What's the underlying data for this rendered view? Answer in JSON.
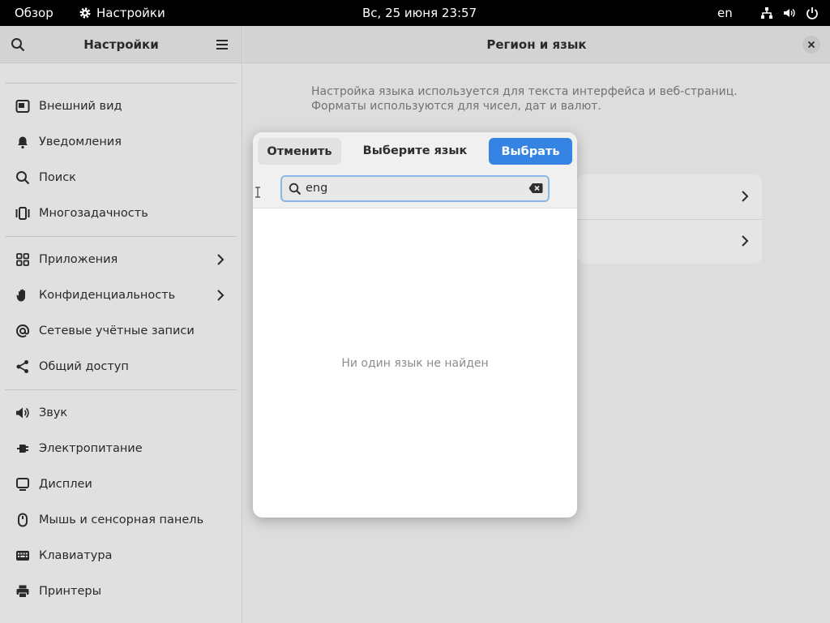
{
  "topbar": {
    "overview": "Обзор",
    "app_name": "Настройки",
    "clock": "Вс, 25 июня  23:57",
    "keyboard_layout": "en"
  },
  "sidebar": {
    "title": "Настройки",
    "items": [
      {
        "label": "Внешний вид",
        "icon": "appearance-icon"
      },
      {
        "label": "Уведомления",
        "icon": "bell-icon"
      },
      {
        "label": "Поиск",
        "icon": "search-icon"
      },
      {
        "label": "Многозадачность",
        "icon": "multitasking-icon"
      },
      {
        "label": "Приложения",
        "icon": "apps-icon"
      },
      {
        "label": "Конфиденциальность",
        "icon": "hand-icon"
      },
      {
        "label": "Сетевые учётные записи",
        "icon": "at-icon"
      },
      {
        "label": "Общий доступ",
        "icon": "share-icon"
      },
      {
        "label": "Звук",
        "icon": "speaker-icon"
      },
      {
        "label": "Электропитание",
        "icon": "power-icon"
      },
      {
        "label": "Дисплеи",
        "icon": "display-icon"
      },
      {
        "label": "Мышь и сенсорная панель",
        "icon": "mouse-icon"
      },
      {
        "label": "Клавиатура",
        "icon": "keyboard-icon"
      },
      {
        "label": "Принтеры",
        "icon": "printer-icon"
      }
    ]
  },
  "main": {
    "title": "Регион и язык",
    "description": "Настройка языка используется для текста интерфейса и веб-страниц. Форматы используются для чисел, дат и валют."
  },
  "dialog": {
    "cancel_label": "Отменить",
    "title": "Выберите язык",
    "select_label": "Выбрать",
    "search_value": "eng",
    "empty_message": "Ни один язык не найден"
  },
  "colors": {
    "accent": "#3584e4",
    "topbar": "#000000"
  }
}
